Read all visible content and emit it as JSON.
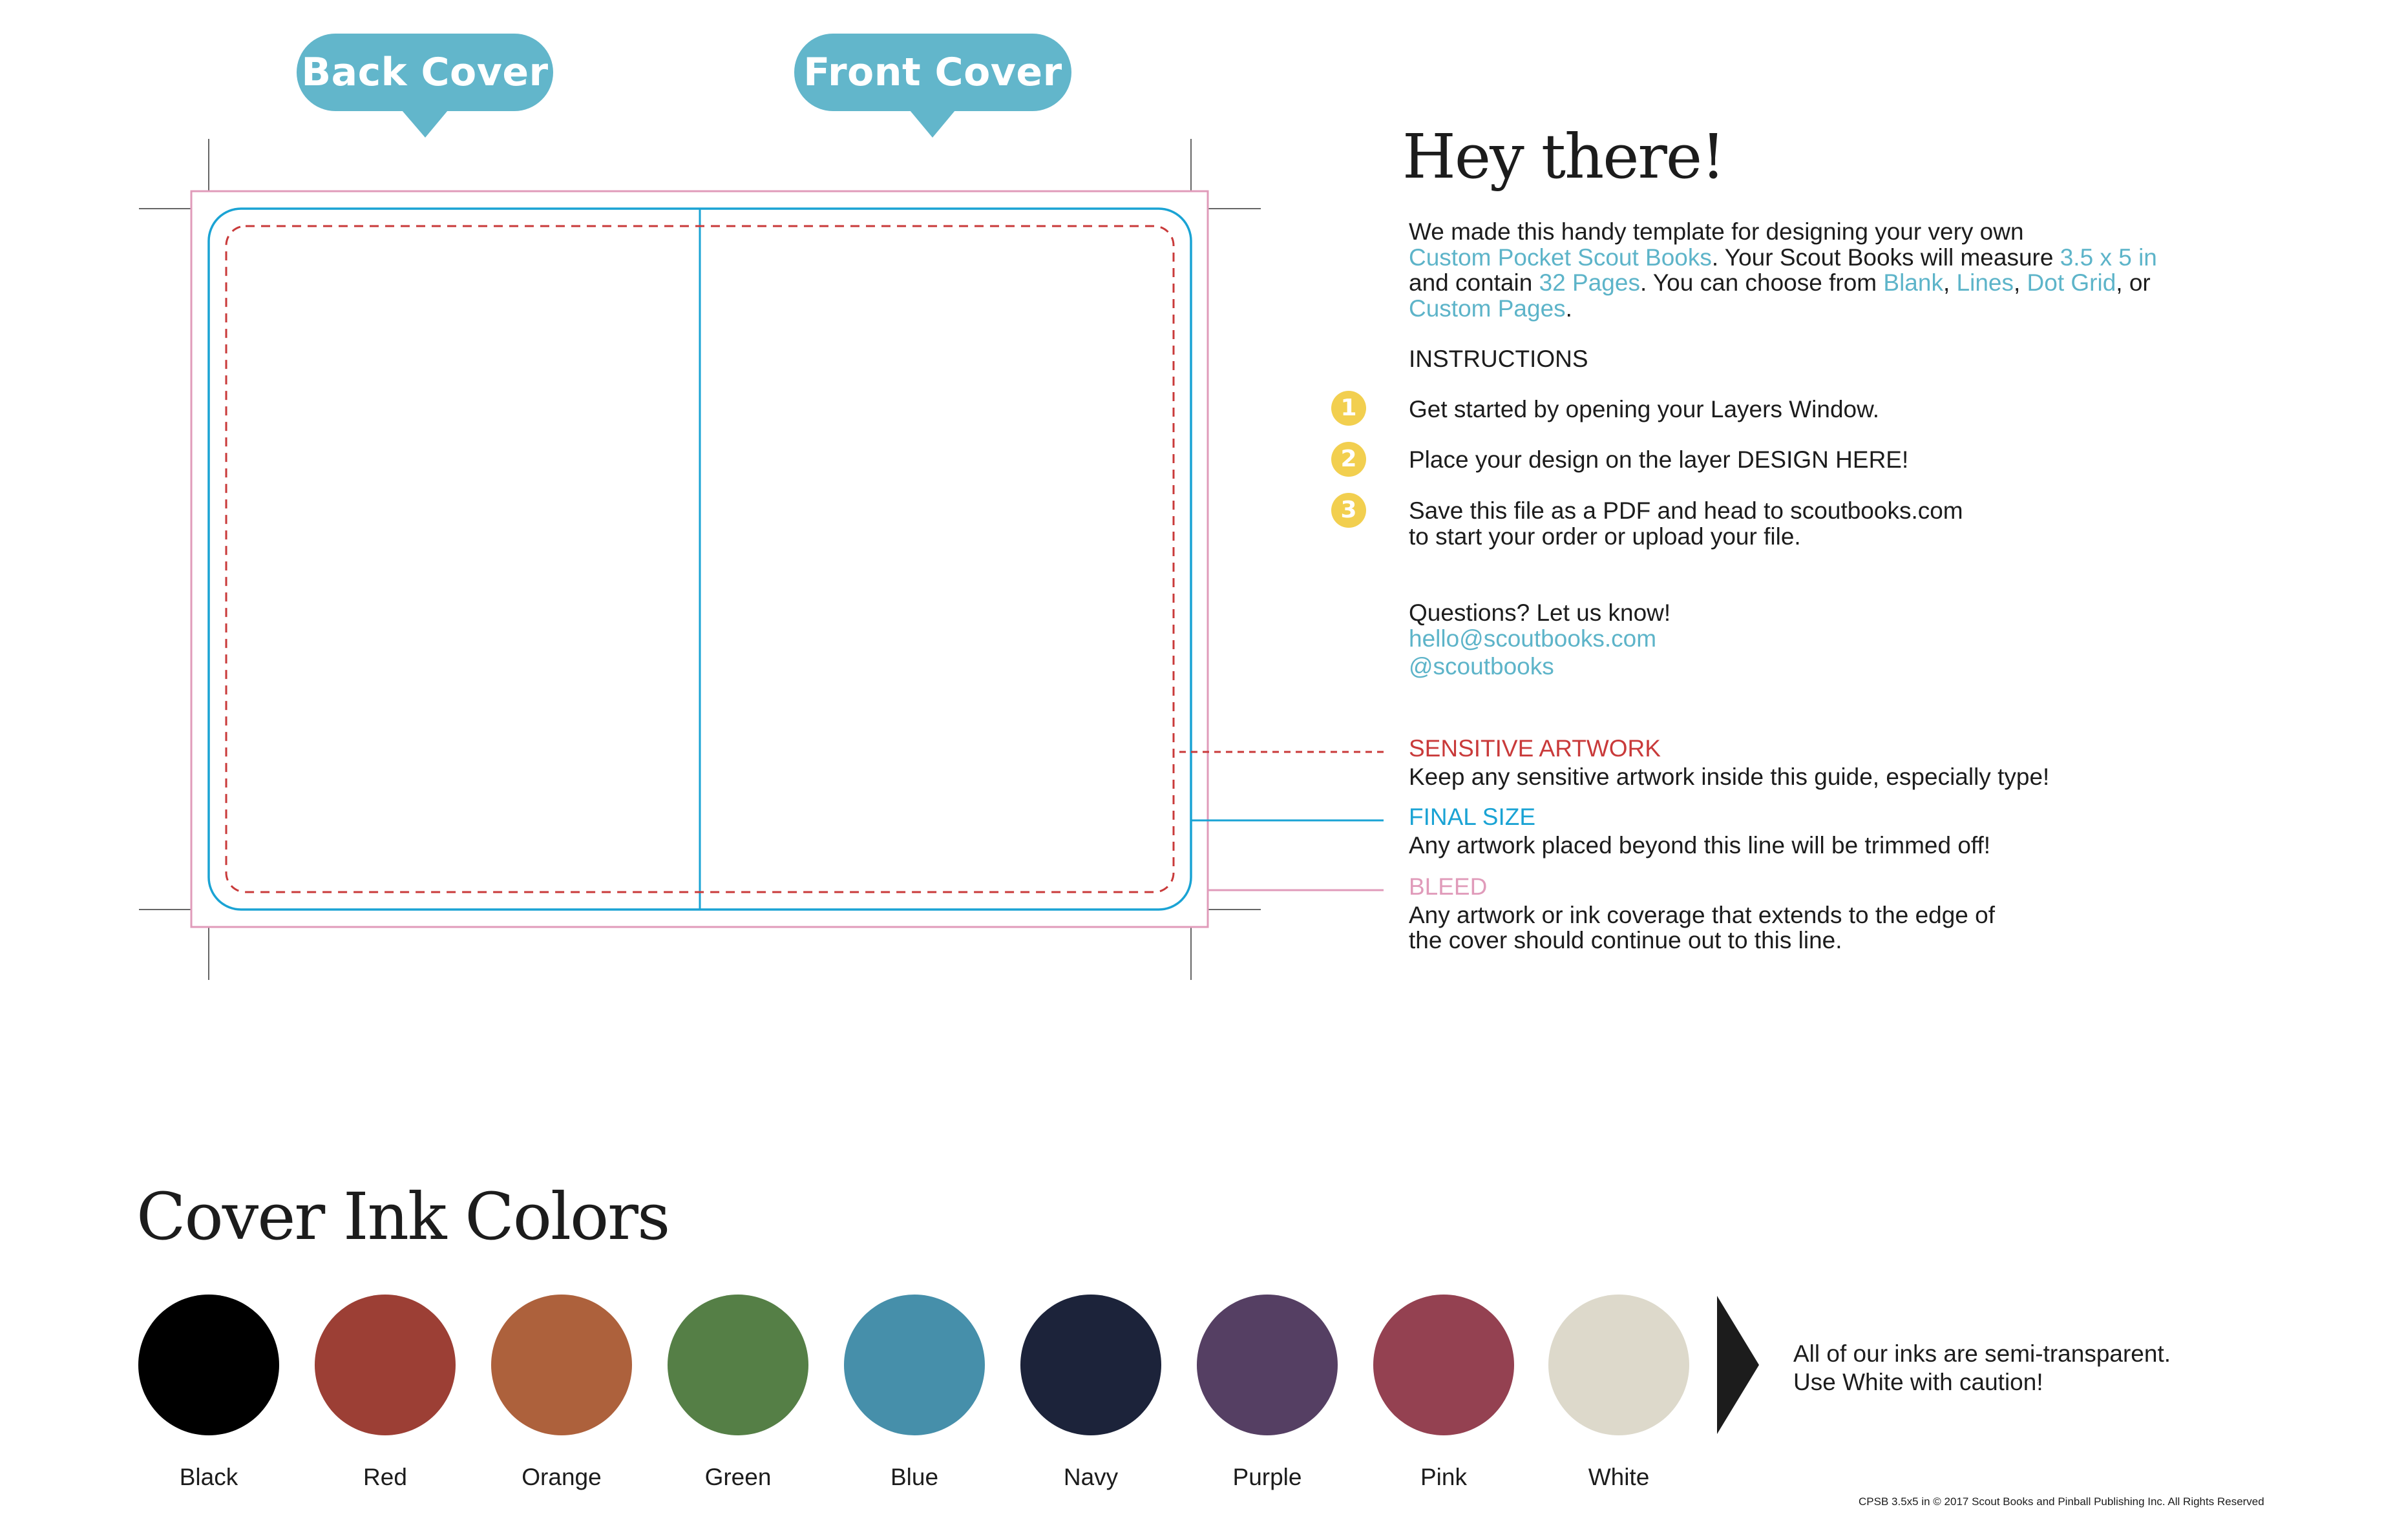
{
  "labels": {
    "back_cover": "Back Cover",
    "front_cover": "Front Cover"
  },
  "intro": {
    "title": "Hey there!",
    "line1": "We made this handy template for designing your very own",
    "line2_link1": "Custom Pocket Scout Books",
    "line2_text": ". Your Scout Books will measure ",
    "line2_link2": "3.5 x 5 in",
    "line3_text1": "and contain ",
    "line3_link1": "32 Pages",
    "line3_text2": ". You can choose from ",
    "line3_link2": "Blank",
    "line3_sep1": ", ",
    "line3_link3": "Lines",
    "line3_sep2": ", ",
    "line3_link4": "Dot Grid",
    "line3_text3": ", or",
    "line4_link": "Custom Pages",
    "line4_text": "."
  },
  "instructions": {
    "heading": "INSTRUCTIONS",
    "steps": [
      {
        "number": "1",
        "lines": [
          "Get started by opening your Layers Window."
        ]
      },
      {
        "number": "2",
        "lines": [
          "Place your design on the layer DESIGN HERE!"
        ]
      },
      {
        "number": "3",
        "lines": [
          "Save this file as a PDF and head to scoutbooks.com",
          "to start your order or upload your file."
        ]
      }
    ]
  },
  "contact": {
    "question": "Questions? Let us know!",
    "email": "hello@scoutbooks.com",
    "handle": "@scoutbooks"
  },
  "guides": {
    "sensitive": {
      "title": "SENSITIVE ARTWORK",
      "desc": "Keep any sensitive artwork inside this guide, especially type!",
      "color": "#c93a3a"
    },
    "final": {
      "title": "FINAL SIZE",
      "desc": "Any artwork placed beyond this line will be trimmed off!",
      "color": "#1aa3d4"
    },
    "bleed": {
      "title": "BLEED",
      "desc_line1": "Any artwork or ink coverage that extends to the edge of",
      "desc_line2": "the cover should continue out to this line.",
      "color": "#e09bba"
    }
  },
  "colors_section": {
    "title": "Cover Ink Colors",
    "swatches": [
      {
        "name": "Black",
        "hex": "#000000"
      },
      {
        "name": "Red",
        "hex": "#9c3f35"
      },
      {
        "name": "Orange",
        "hex": "#ad613c"
      },
      {
        "name": "Green",
        "hex": "#557f46"
      },
      {
        "name": "Blue",
        "hex": "#468faa"
      },
      {
        "name": "Navy",
        "hex": "#1c233a"
      },
      {
        "name": "Purple",
        "hex": "#553f63"
      },
      {
        "name": "Pink",
        "hex": "#944151"
      },
      {
        "name": "White",
        "hex": "#ddd9cb"
      }
    ],
    "note_line1": "All of our inks are semi-transparent.",
    "note_line2": "Use White with caution!"
  },
  "footer": "CPSB 3.5x5 in © 2017 Scout Books and Pinball Publishing Inc. All Rights Reserved",
  "theme": {
    "accent": "#62b6cb",
    "badge": "#f2cf4f",
    "text": "#1c1c1c"
  }
}
